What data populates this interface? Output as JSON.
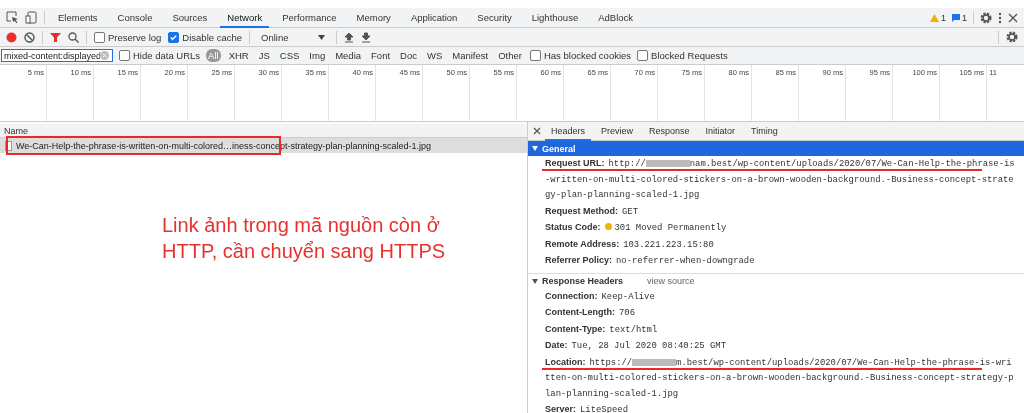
{
  "panel_tabs": [
    {
      "label": "Elements",
      "selected": false
    },
    {
      "label": "Console",
      "selected": false
    },
    {
      "label": "Sources",
      "selected": false
    },
    {
      "label": "Network",
      "selected": true
    },
    {
      "label": "Performance",
      "selected": false
    },
    {
      "label": "Memory",
      "selected": false
    },
    {
      "label": "Application",
      "selected": false
    },
    {
      "label": "Security",
      "selected": false
    },
    {
      "label": "Lighthouse",
      "selected": false
    },
    {
      "label": "AdBlock",
      "selected": false
    }
  ],
  "badges": {
    "warnings": "1",
    "messages": "1"
  },
  "toolbar": {
    "recording": true,
    "preserve_log": {
      "label": "Preserve log",
      "checked": false
    },
    "disable_cache": {
      "label": "Disable cache",
      "checked": true
    },
    "throttling": "Online"
  },
  "filter": {
    "value": "mixed-content:displayed",
    "hide_data_urls": {
      "label": "Hide data URLs",
      "checked": false
    },
    "types": [
      {
        "label": "All",
        "selected": true
      },
      {
        "label": "XHR",
        "selected": false
      },
      {
        "label": "JS",
        "selected": false
      },
      {
        "label": "CSS",
        "selected": false
      },
      {
        "label": "Img",
        "selected": false
      },
      {
        "label": "Media",
        "selected": false
      },
      {
        "label": "Font",
        "selected": false
      },
      {
        "label": "Doc",
        "selected": false
      },
      {
        "label": "WS",
        "selected": false
      },
      {
        "label": "Manifest",
        "selected": false
      },
      {
        "label": "Other",
        "selected": false
      }
    ],
    "has_blocked_cookies": {
      "label": "Has blocked cookies",
      "checked": false
    },
    "blocked_requests": {
      "label": "Blocked Requests",
      "checked": false
    }
  },
  "timeline_ticks": [
    "5 ms",
    "10 ms",
    "15 ms",
    "20 ms",
    "25 ms",
    "30 ms",
    "35 ms",
    "40 ms",
    "45 ms",
    "50 ms",
    "55 ms",
    "60 ms",
    "65 ms",
    "70 ms",
    "75 ms",
    "80 ms",
    "85 ms",
    "90 ms",
    "95 ms",
    "100 ms",
    "105 ms",
    "11"
  ],
  "requests": {
    "column": "Name",
    "rows": [
      {
        "name": "We-Can-Help-the-phrase-is-written-on-multi-colored…iness-concept-strategy-plan-planning-scaled-1.jpg",
        "selected": true,
        "highlighted": true
      }
    ]
  },
  "annotation": [
    "Link ảnh trong mã nguồn còn ở",
    "HTTP, cần chuyển sang HTTPS"
  ],
  "detail_tabs": [
    {
      "label": "Headers",
      "selected": true
    },
    {
      "label": "Preview",
      "selected": false
    },
    {
      "label": "Response",
      "selected": false
    },
    {
      "label": "Initiator",
      "selected": false
    },
    {
      "label": "Timing",
      "selected": false
    }
  ],
  "sections": [
    {
      "title": "General",
      "selected": true,
      "expanded": true,
      "items": [
        {
          "key": "Request URL:",
          "prefix": "http://",
          "redacted": true,
          "value": "nam.best/wp-content/uploads/2020/07/We-Can-Help-the-phrase-is-written-on-multi-colored-stickers-on-a-brown-wooden-background.-Business-concept-strategy-plan-planning-scaled-1.jpg",
          "underlined": true
        },
        {
          "key": "Request Method:",
          "value": "GET"
        },
        {
          "key": "Status Code:",
          "value": "301 Moved Permanently",
          "color": "#f0b400"
        },
        {
          "key": "Remote Address:",
          "value": "103.221.223.15:80"
        },
        {
          "key": "Referrer Policy:",
          "value": "no-referrer-when-downgrade"
        }
      ]
    },
    {
      "title": "Response Headers",
      "link": "view source",
      "selected": false,
      "expanded": true,
      "items": [
        {
          "key": "Connection:",
          "value": "Keep-Alive"
        },
        {
          "key": "Content-Length:",
          "value": "706"
        },
        {
          "key": "Content-Type:",
          "value": "text/html"
        },
        {
          "key": "Date:",
          "value": "Tue, 28 Jul 2020 08:40:25 GMT"
        },
        {
          "key": "Location:",
          "prefix": "https://",
          "redacted": true,
          "value": "m.best/wp-content/uploads/2020/07/We-Can-Help-the-phrase-is-written-on-multi-colored-stickers-on-a-brown-wooden-background.-Business-concept-strategy-plan-planning-scaled-1.jpg",
          "underlined": true
        },
        {
          "key": "Server:",
          "value": "LiteSpeed"
        }
      ]
    }
  ]
}
